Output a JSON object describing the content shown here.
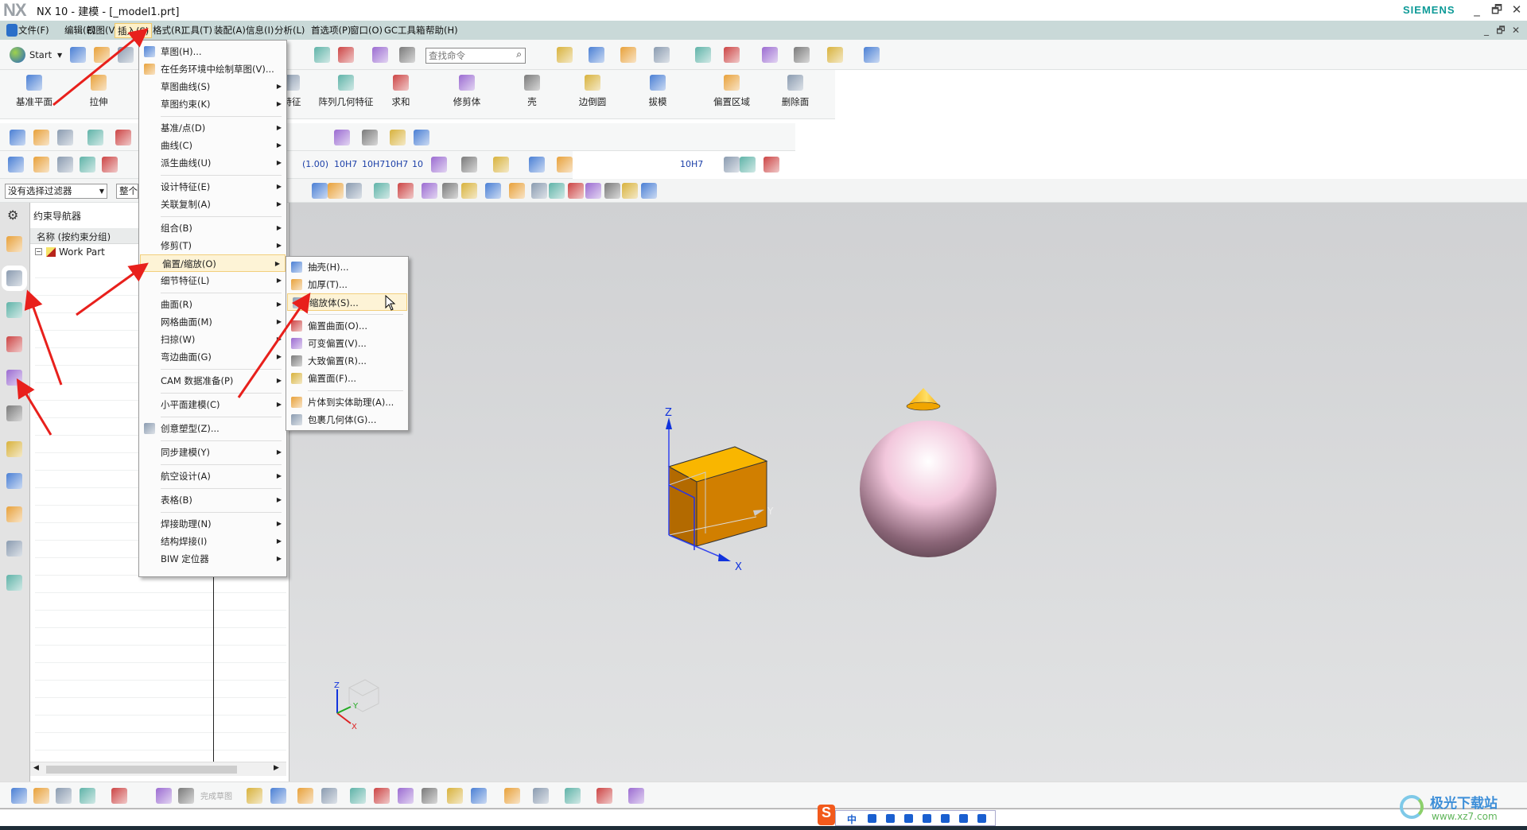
{
  "window": {
    "logo": "NX",
    "title": "NX 10 - 建模 - [_model1.prt]",
    "brand": "SIEMENS",
    "minimize": "_",
    "restore": "🗗",
    "close": "✕"
  },
  "menubar": {
    "items": [
      "文件(F)",
      "编辑(E)",
      "视图(V)",
      "插入(S)",
      "格式(R)",
      "工具(T)",
      "装配(A)",
      "信息(I)",
      "分析(L)",
      "首选项(P)",
      "窗口(O)",
      "GC工具箱",
      "帮助(H)"
    ],
    "active": "插入(S)"
  },
  "toolbar1": {
    "start_label": "Start",
    "search_placeholder": "查找命令"
  },
  "ribbon": {
    "items": [
      "基准平面",
      "拉伸",
      "特征",
      "阵列几何特征",
      "求和",
      "修剪体",
      "壳",
      "边倒圆",
      "拔模",
      "偏置区域",
      "删除面"
    ]
  },
  "toolbar4_text": [
    "(1.00)",
    "10H7",
    "10H7",
    "10H7",
    "10",
    "10H7"
  ],
  "filter": {
    "selection_filter": "没有选择过滤器",
    "scope": "整个"
  },
  "navigator": {
    "title": "约束导航器",
    "column": "名称 (按约束分组)",
    "root": "Work Part"
  },
  "insert_menu": {
    "items": [
      {
        "label": "草图(H)...",
        "icon": "sketch-icon",
        "sub": false
      },
      {
        "label": "在任务环境中绘制草图(V)...",
        "icon": "task-sketch-icon",
        "sub": false
      },
      {
        "label": "草图曲线(S)",
        "sub": true
      },
      {
        "label": "草图约束(K)",
        "sub": true
      },
      {
        "sep": true
      },
      {
        "label": "基准/点(D)",
        "sub": true
      },
      {
        "label": "曲线(C)",
        "sub": true
      },
      {
        "label": "派生曲线(U)",
        "sub": true
      },
      {
        "sep": true
      },
      {
        "label": "设计特征(E)",
        "sub": true
      },
      {
        "label": "关联复制(A)",
        "sub": true
      },
      {
        "sep": true
      },
      {
        "label": "组合(B)",
        "sub": true
      },
      {
        "label": "修剪(T)",
        "sub": true
      },
      {
        "label": "偏置/缩放(O)",
        "sub": true,
        "highlighted": true
      },
      {
        "label": "细节特征(L)",
        "sub": true
      },
      {
        "sep": true
      },
      {
        "label": "曲面(R)",
        "sub": true
      },
      {
        "label": "网格曲面(M)",
        "sub": true
      },
      {
        "label": "扫掠(W)",
        "sub": true
      },
      {
        "label": "弯边曲面(G)",
        "sub": true
      },
      {
        "sep": true
      },
      {
        "label": "CAM 数据准备(P)",
        "sub": true
      },
      {
        "sep": true
      },
      {
        "label": "小平面建模(C)",
        "sub": true
      },
      {
        "sep": true
      },
      {
        "label": "创意塑型(Z)...",
        "icon": "realize-shape-icon",
        "sub": false
      },
      {
        "sep": true
      },
      {
        "label": "同步建模(Y)",
        "sub": true
      },
      {
        "sep": true
      },
      {
        "label": "航空设计(A)",
        "sub": true
      },
      {
        "sep": true
      },
      {
        "label": "表格(B)",
        "sub": true
      },
      {
        "sep": true
      },
      {
        "label": "焊接助理(N)",
        "sub": true
      },
      {
        "label": "结构焊接(I)",
        "sub": true
      },
      {
        "label": "BIW 定位器",
        "sub": true
      }
    ]
  },
  "offset_submenu": {
    "items": [
      {
        "label": "抽壳(H)...",
        "icon": "shell-icon"
      },
      {
        "label": "加厚(T)...",
        "icon": "thicken-icon"
      },
      {
        "label": "缩放体(S)...",
        "icon": "scale-body-icon",
        "highlighted": true
      },
      {
        "sep": true
      },
      {
        "label": "偏置曲面(O)...",
        "icon": "offset-surface-icon"
      },
      {
        "label": "可变偏置(V)...",
        "icon": "variable-offset-icon"
      },
      {
        "label": "大致偏置(R)...",
        "icon": "rough-offset-icon"
      },
      {
        "label": "偏置面(F)...",
        "icon": "offset-face-icon"
      },
      {
        "sep": true
      },
      {
        "label": "片体到实体助理(A)...",
        "icon": "sheet-to-solid-icon"
      },
      {
        "label": "包裹几何体(G)...",
        "icon": "wrap-geometry-icon"
      }
    ]
  },
  "viewport": {
    "axes": {
      "x": "X",
      "y": "Y",
      "z": "Z"
    }
  },
  "bottombar": {
    "finish_sketch": "完成草图"
  },
  "ime": {
    "mode": "中"
  },
  "watermark": {
    "name": "极光下载站",
    "url": "www.xz7.com"
  },
  "colors": {
    "menubar": "#c9d9d8",
    "highlight": "#fdf3d6",
    "annotation_arrow": "#e8201c",
    "cube": "#d98a00",
    "sphere": "#e8c4d6",
    "accent": "#0d9a97"
  }
}
